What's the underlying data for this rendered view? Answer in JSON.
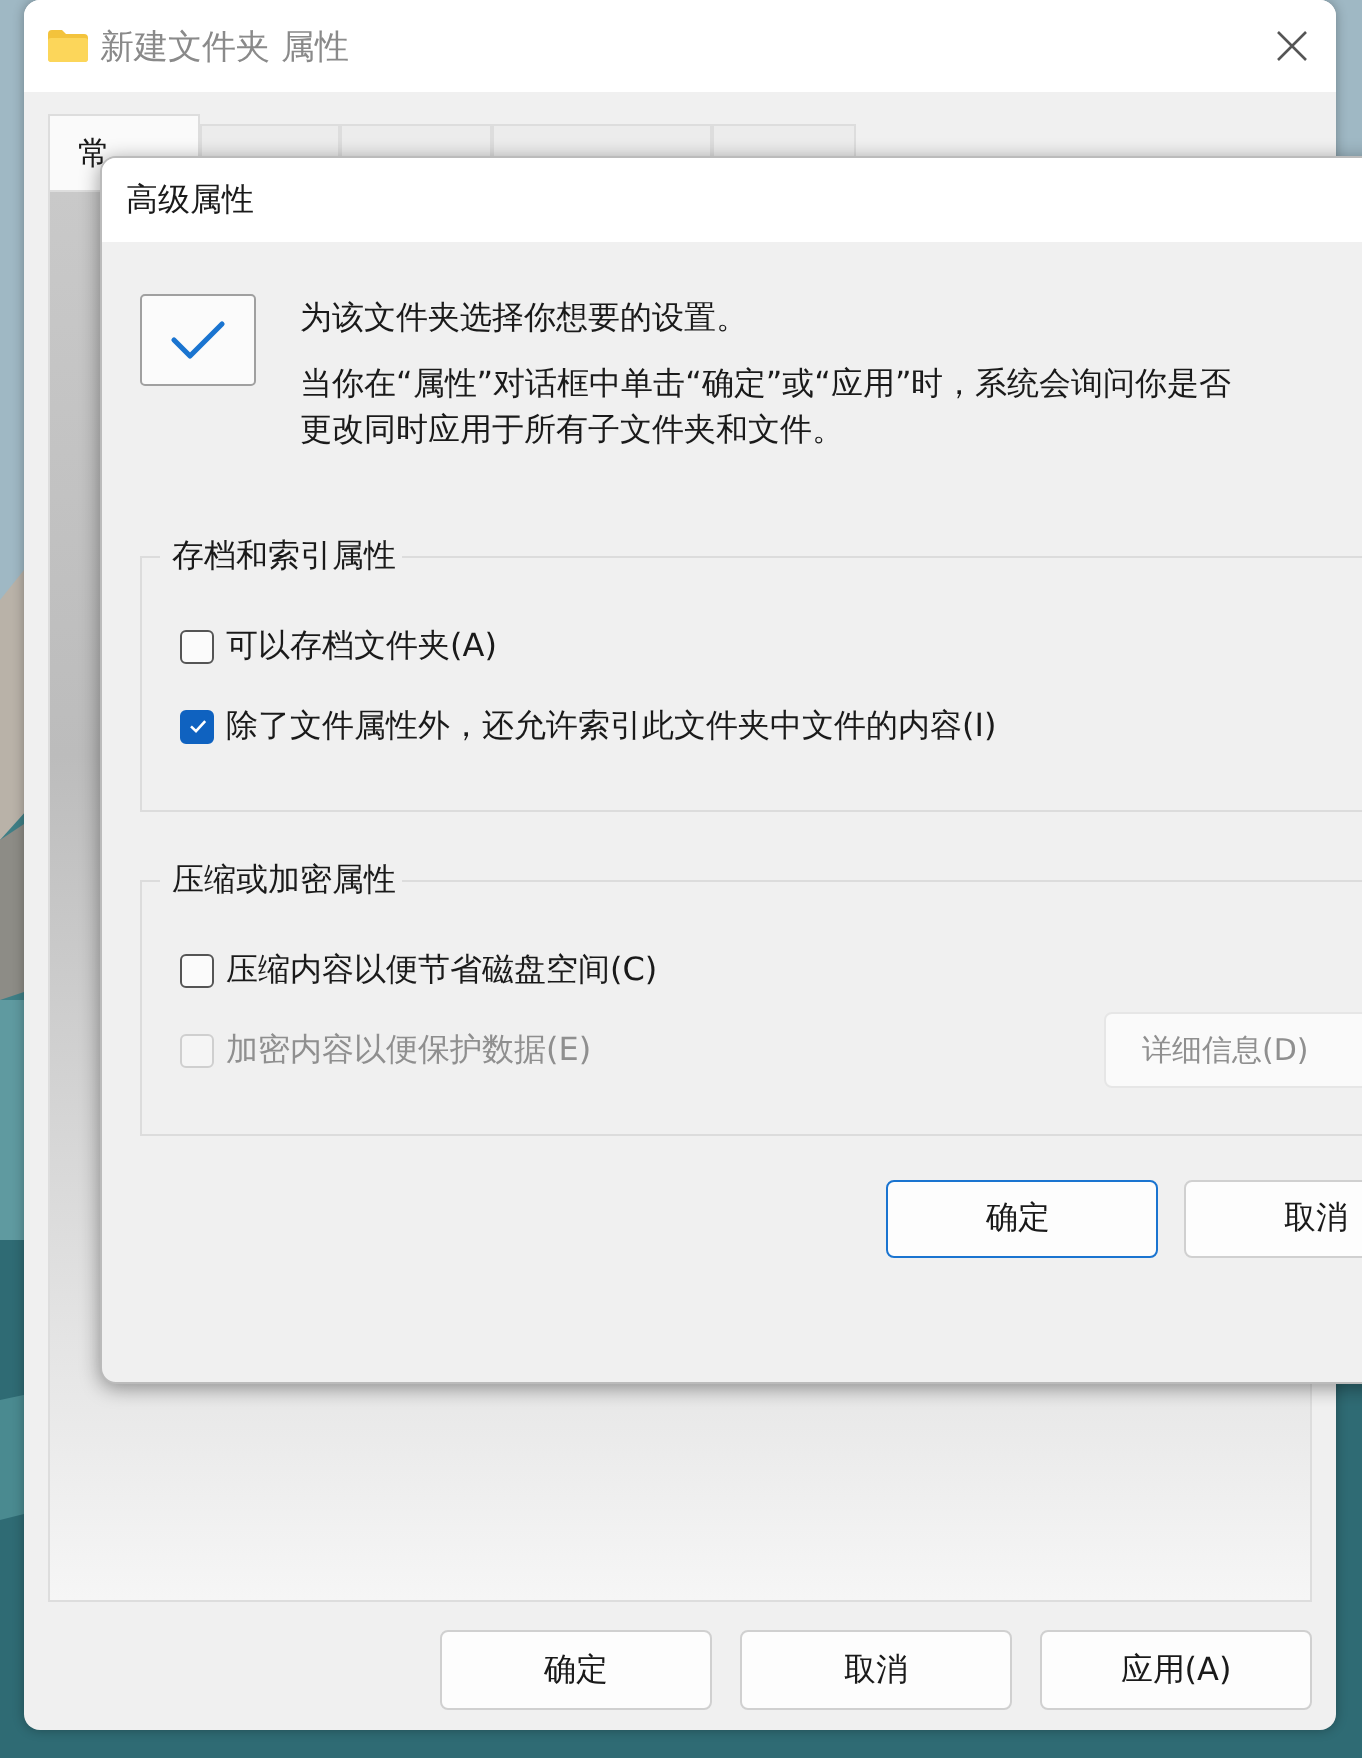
{
  "window": {
    "title": "新建文件夹 属性",
    "tabs": [
      {
        "label": "常",
        "selected": true
      },
      {
        "selected": false
      },
      {
        "selected": false
      },
      {
        "selected": false
      },
      {
        "selected": false
      }
    ],
    "buttons": [
      {
        "label": "确定"
      },
      {
        "label": "取消"
      },
      {
        "label": "应用(A)"
      }
    ]
  },
  "dialog": {
    "title": "高级属性",
    "heading": "为该文件夹选择你想要的设置。",
    "description": [
      "当你在“属性”对话框中单击“确定”或“应用”时，系统会询问你是否",
      "更改同时应用于所有子文件夹和文件。"
    ],
    "groups": [
      {
        "title": "存档和索引属性",
        "options": [
          {
            "label": "可以存档文件夹(A)",
            "checked": false,
            "disabled": false
          },
          {
            "label": "除了文件属性外，还允许索引此文件夹中文件的内容(I)",
            "checked": true,
            "disabled": false
          }
        ]
      },
      {
        "title": "压缩或加密属性",
        "options": [
          {
            "label": "压缩内容以便节省磁盘空间(C)",
            "checked": false,
            "disabled": false
          },
          {
            "label": "加密内容以便保护数据(E)",
            "checked": false,
            "disabled": true
          }
        ],
        "details_button": {
          "label": "详细信息(D)",
          "disabled": true
        }
      }
    ],
    "buttons": [
      {
        "label": "确定",
        "default": true
      },
      {
        "label": "取消",
        "default": false
      }
    ]
  }
}
